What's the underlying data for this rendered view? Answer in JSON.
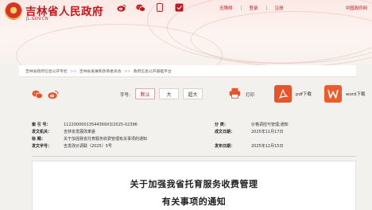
{
  "header": {
    "site_title": "吉林省人民政府",
    "site_domain": "JL.GOV.CN",
    "links": [
      "无障碍",
      "登录",
      "注册"
    ],
    "lang_link": "中国政府网",
    "icons": [
      "weibo-icon",
      "wechat-icon",
      "mobile-icon",
      "app-icon"
    ],
    "brand_color": "#c8161d"
  },
  "breadcrumb": {
    "items": [
      "吉林省政府信息公开专栏",
      "吉林省发展和改革委员会",
      "政府信息公开基础平台"
    ],
    "separator": ">>"
  },
  "toolbar": {
    "share_icons": [
      "wechat-icon",
      "weibo-icon"
    ],
    "fontsize_label": "字号:",
    "fontsize_options": [
      "默认",
      "大",
      "超大"
    ],
    "print_label": "打印",
    "pdf_label": "pdf下载",
    "word_label": "word下载"
  },
  "meta": {
    "index_label": "索  引  号：",
    "index_value": "11220000013544369X3/2025-02396",
    "category_label": "分        类：",
    "category_value": "价格调控与管理;通知",
    "issuer_label": "发文机关：",
    "issuer_value": "吉林省发展改革委",
    "date_label": "成文日期：",
    "date_value": "2025年11月17日",
    "title_label": "标        题：",
    "title_value": "关于加强我省托育服务收费管理有关事项的通知",
    "docno_label": "发文字号：",
    "docno_value": "吉发改价调联〔2025〕5号",
    "pubdate_label": "发布日期：",
    "pubdate_value": "2025年12月15日"
  },
  "document": {
    "title_line1": "关于加强我省托育服务收费管理",
    "title_line2": "有关事项的通知"
  }
}
